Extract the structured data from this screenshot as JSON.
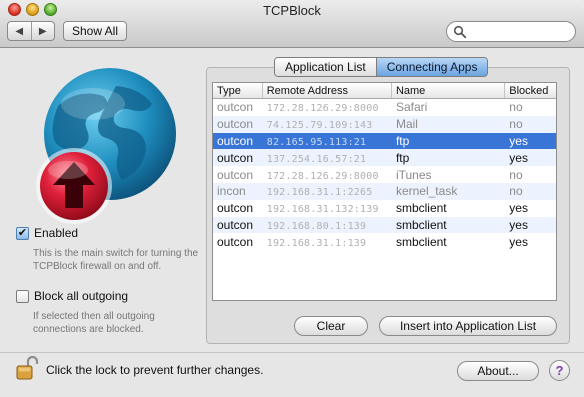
{
  "window": {
    "title": "TCPBlock",
    "show_all_label": "Show All",
    "search_placeholder": ""
  },
  "nav": {
    "back_glyph": "◀",
    "forward_glyph": "▶"
  },
  "left": {
    "enabled_label": "Enabled",
    "enabled_checked": true,
    "enabled_hint": "This is the main switch for turning the TCPBlock firewall on and off.",
    "block_all_label": "Block all outgoing",
    "block_all_checked": false,
    "block_all_hint": "If selected then all outgoing connections are blocked.",
    "icons": [
      "globe-icon",
      "upload-arrow-icon"
    ]
  },
  "tabs": [
    {
      "label": "Application List",
      "active": false
    },
    {
      "label": "Connecting Apps",
      "active": true
    }
  ],
  "table": {
    "columns": [
      "Type",
      "Remote Address",
      "Name",
      "Blocked"
    ],
    "rows": [
      {
        "type": "outcon",
        "address": "172.28.126.29:8000",
        "name": "Safari",
        "blocked": "no",
        "state": "dim"
      },
      {
        "type": "outcon",
        "address": "74.125.79.109:143",
        "name": "Mail",
        "blocked": "no",
        "state": "dim"
      },
      {
        "type": "outcon",
        "address": "82.165.95.113:21",
        "name": "ftp",
        "blocked": "yes",
        "state": "selected"
      },
      {
        "type": "outcon",
        "address": "137.254.16.57:21",
        "name": "ftp",
        "blocked": "yes",
        "state": "normal"
      },
      {
        "type": "outcon",
        "address": "172.28.126.29:8000",
        "name": "iTunes",
        "blocked": "no",
        "state": "dim"
      },
      {
        "type": "incon",
        "address": "192.168.31.1:2265",
        "name": "kernel_task",
        "blocked": "no",
        "state": "dim"
      },
      {
        "type": "outcon",
        "address": "192.168.31.132:139",
        "name": "smbclient",
        "blocked": "yes",
        "state": "normal"
      },
      {
        "type": "outcon",
        "address": "192.168.80.1:139",
        "name": "smbclient",
        "blocked": "yes",
        "state": "normal"
      },
      {
        "type": "outcon",
        "address": "192.168.31.1:139",
        "name": "smbclient",
        "blocked": "yes",
        "state": "normal"
      }
    ]
  },
  "buttons": {
    "clear": "Clear",
    "insert": "Insert into Application List",
    "about": "About...",
    "help": "?"
  },
  "footer": {
    "lock_text": "Click the lock to prevent further changes."
  },
  "colors": {
    "selection": "#3875d7",
    "tab_active": "#6aa3e0",
    "globe": "#1f8fbf",
    "arrow_badge": "#d4102a"
  }
}
